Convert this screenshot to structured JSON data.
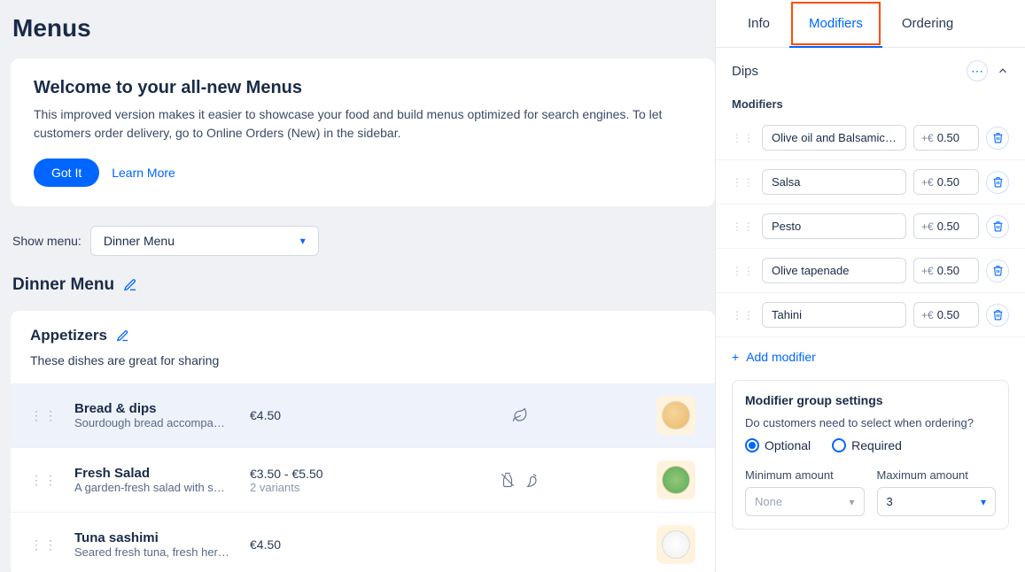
{
  "page": {
    "title": "Menus"
  },
  "welcome": {
    "title": "Welcome to your all-new Menus",
    "description": "This improved version makes it easier to showcase your food and build menus optimized for search engines.  To let customers order delivery, go to Online Orders (New) in the sidebar.",
    "got_it": "Got It",
    "learn_more": "Learn More"
  },
  "filter": {
    "label": "Show menu:",
    "selected": "Dinner Menu"
  },
  "menu": {
    "name": "Dinner Menu"
  },
  "section": {
    "name": "Appetizers",
    "description": "These dishes are great for sharing"
  },
  "items": [
    {
      "name": "Bread & dips",
      "desc": "Sourdough bread accompa…",
      "price": "€4.50",
      "variants": ""
    },
    {
      "name": "Fresh Salad",
      "desc": "A garden-fresh salad with s…",
      "price": "€3.50 - €5.50",
      "variants": "2 variants"
    },
    {
      "name": "Tuna sashimi",
      "desc": "Seared fresh tuna, fresh her…",
      "price": "€4.50",
      "variants": ""
    }
  ],
  "tabs": {
    "info": "Info",
    "modifiers": "Modifiers",
    "ordering": "Ordering"
  },
  "group": {
    "name": "Dips",
    "modifiers_label": "Modifiers",
    "price_prefix": "+€",
    "items": [
      {
        "name": "Olive oil and Balsamic vinegar",
        "price": "0.50"
      },
      {
        "name": "Salsa",
        "price": "0.50"
      },
      {
        "name": "Pesto",
        "price": "0.50"
      },
      {
        "name": "Olive tapenade",
        "price": "0.50"
      },
      {
        "name": "Tahini",
        "price": "0.50"
      }
    ],
    "add_label": "Add modifier"
  },
  "settings": {
    "title": "Modifier group settings",
    "question": "Do customers need to select when ordering?",
    "optional": "Optional",
    "required": "Required",
    "min_label": "Minimum amount",
    "min_value": "None",
    "max_label": "Maximum amount",
    "max_value": "3"
  }
}
